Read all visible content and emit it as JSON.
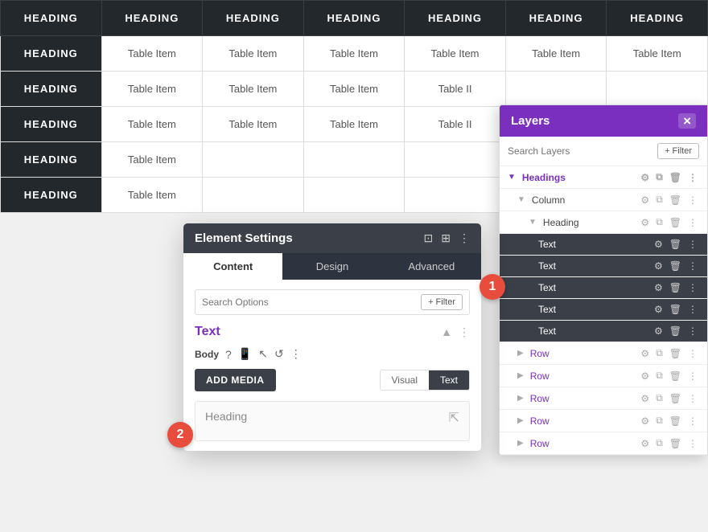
{
  "table": {
    "headings": [
      "HEADING",
      "HEADING",
      "HEADING",
      "HEADING",
      "HEADING",
      "HEADING",
      "HEADING"
    ],
    "rows": [
      [
        "HEADING",
        "Table Item",
        "Table Item",
        "Table Item",
        "Table Item",
        "Table Item",
        "Table Item"
      ],
      [
        "HEADING",
        "Table Item",
        "Table Item",
        "Table Item",
        "Table II",
        "",
        ""
      ],
      [
        "HEADING",
        "Table Item",
        "Table Item",
        "Table Item",
        "Table II",
        "",
        ""
      ],
      [
        "HEADING",
        "Table Item",
        "",
        "",
        "",
        "",
        ""
      ],
      [
        "HEADING",
        "Table Item",
        "",
        "",
        "",
        "",
        ""
      ]
    ]
  },
  "layers": {
    "title": "Layers",
    "close_label": "×",
    "search_placeholder": "Search Layers",
    "filter_label": "+ Filter",
    "items": [
      {
        "label": "Headings",
        "type": "purple",
        "indent": 0
      },
      {
        "label": "Column",
        "type": "normal",
        "indent": 1
      },
      {
        "label": "Heading",
        "type": "normal",
        "indent": 2
      },
      {
        "label": "Text",
        "type": "dark",
        "indent": 3
      },
      {
        "label": "Text",
        "type": "dark",
        "indent": 3
      },
      {
        "label": "Text",
        "type": "dark",
        "indent": 3
      },
      {
        "label": "Text",
        "type": "dark",
        "indent": 3
      },
      {
        "label": "Text",
        "type": "dark",
        "indent": 3
      },
      {
        "label": "Row",
        "type": "row",
        "indent": 1
      },
      {
        "label": "Row",
        "type": "row",
        "indent": 1
      },
      {
        "label": "Row",
        "type": "row",
        "indent": 1
      },
      {
        "label": "Row",
        "type": "row",
        "indent": 1
      },
      {
        "label": "Row",
        "type": "row",
        "indent": 1
      }
    ]
  },
  "element_settings": {
    "title": "Element Settings",
    "tabs": [
      "Content",
      "Design",
      "Advanced"
    ],
    "active_tab": "Content",
    "search_placeholder": "Search Options",
    "filter_label": "+ Filter",
    "section_title": "Text",
    "toolbar_label": "Body",
    "add_media_label": "ADD MEDIA",
    "view_tabs": [
      "Visual",
      "Text"
    ],
    "active_view": "Text",
    "content_placeholder": "Heading"
  },
  "badges": [
    {
      "id": "badge1",
      "label": "1"
    },
    {
      "id": "badge2",
      "label": "2"
    }
  ]
}
